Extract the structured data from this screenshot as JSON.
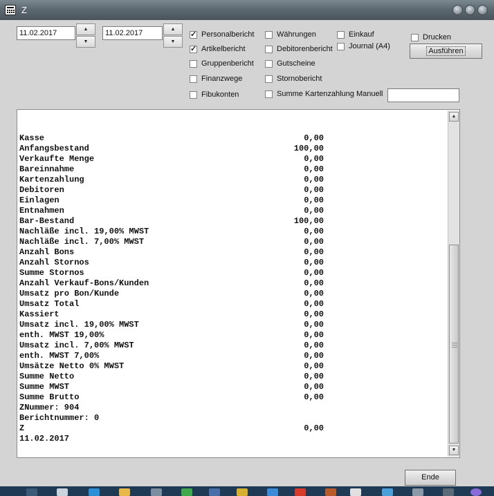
{
  "window": {
    "title": "Z"
  },
  "dates": {
    "from": "11.02.2017",
    "to": "11.02.2017"
  },
  "checkboxes": [
    {
      "id": "personalbericht",
      "label": "Personalbericht",
      "checked": true
    },
    {
      "id": "artikelbericht",
      "label": "Artikelbericht",
      "checked": true
    },
    {
      "id": "gruppenbericht",
      "label": "Gruppenbericht",
      "checked": false
    },
    {
      "id": "finanzwege",
      "label": "Finanzwege",
      "checked": false
    },
    {
      "id": "fibukonten",
      "label": "Fibukonten",
      "checked": false
    },
    {
      "id": "waehrungen",
      "label": "Währungen",
      "checked": false
    },
    {
      "id": "debitorenbericht",
      "label": "Debitorenbericht",
      "checked": false
    },
    {
      "id": "gutscheine",
      "label": "Gutscheine",
      "checked": false
    },
    {
      "id": "stornobericht",
      "label": "Stornobericht",
      "checked": false
    },
    {
      "id": "summe-kartenzahlung",
      "label": "Summe Kartenzahlung Manuell",
      "checked": false
    },
    {
      "id": "einkauf",
      "label": "Einkauf",
      "checked": false
    },
    {
      "id": "journal",
      "label": "Journal (A4)",
      "checked": false
    },
    {
      "id": "drucken",
      "label": "Drucken",
      "checked": false
    }
  ],
  "kartenzahlung_value": "",
  "buttons": {
    "ausfuehren": "Ausführen",
    "ende": "Ende"
  },
  "report_lines": [
    {
      "label": "Kasse",
      "value": "0,00"
    },
    {
      "label": "Anfangsbestand",
      "value": "100,00"
    },
    {
      "label": "Verkaufte Menge",
      "value": "0,00"
    },
    {
      "label": "Bareinnahme",
      "value": "0,00"
    },
    {
      "label": "Kartenzahlung",
      "value": "0,00"
    },
    {
      "label": "Debitoren",
      "value": "0,00"
    },
    {
      "label": "Einlagen",
      "value": "0,00"
    },
    {
      "label": "Entnahmen",
      "value": "0,00"
    },
    {
      "label": "Bar-Bestand",
      "value": "100,00"
    },
    {
      "label": "Nachläße incl. 19,00% MWST",
      "value": "0,00"
    },
    {
      "label": "Nachläße incl. 7,00% MWST",
      "value": "0,00"
    },
    {
      "label": "Anzahl Bons",
      "value": "0,00"
    },
    {
      "label": "Anzahl Stornos",
      "value": "0,00"
    },
    {
      "label": "Summe Stornos",
      "value": "0,00"
    },
    {
      "label": "Anzahl Verkauf-Bons/Kunden",
      "value": "0,00"
    },
    {
      "label": "Umsatz pro Bon/Kunde",
      "value": "0,00"
    },
    {
      "label": "Umsatz Total",
      "value": "0,00"
    },
    {
      "label": "Kassiert",
      "value": "0,00"
    },
    {
      "label": "Umsatz incl. 19,00% MWST",
      "value": "0,00"
    },
    {
      "label": "enth. MWST 19,00%",
      "value": "0,00"
    },
    {
      "label": "Umsatz incl. 7,00% MWST",
      "value": "0,00"
    },
    {
      "label": "enth. MWST 7,00%",
      "value": "0,00"
    },
    {
      "label": "Umsätze Netto 0% MWST",
      "value": "0,00"
    },
    {
      "label": "Summe Netto",
      "value": "0,00"
    },
    {
      "label": "Summe MWST",
      "value": "0,00"
    },
    {
      "label": "Summe Brutto",
      "value": "0,00"
    },
    {
      "label": "ZNummer: 904",
      "value": ""
    },
    {
      "label": "Berichtnummer: 0",
      "value": ""
    },
    {
      "label": "Z",
      "value": "0,00"
    },
    {
      "label": "11.02.2017",
      "value": ""
    }
  ],
  "icons": {
    "app": "calculator-icon",
    "minimize": "minimize-icon",
    "maximize": "maximize-icon",
    "close": "close-icon",
    "spin_up": "arrow-up-icon",
    "spin_down": "arrow-down-icon",
    "check": "check-icon"
  },
  "colors": {
    "titlebar": "#5e6a72",
    "window_bg": "#d4d4d4",
    "report_bg": "#ffffff"
  }
}
